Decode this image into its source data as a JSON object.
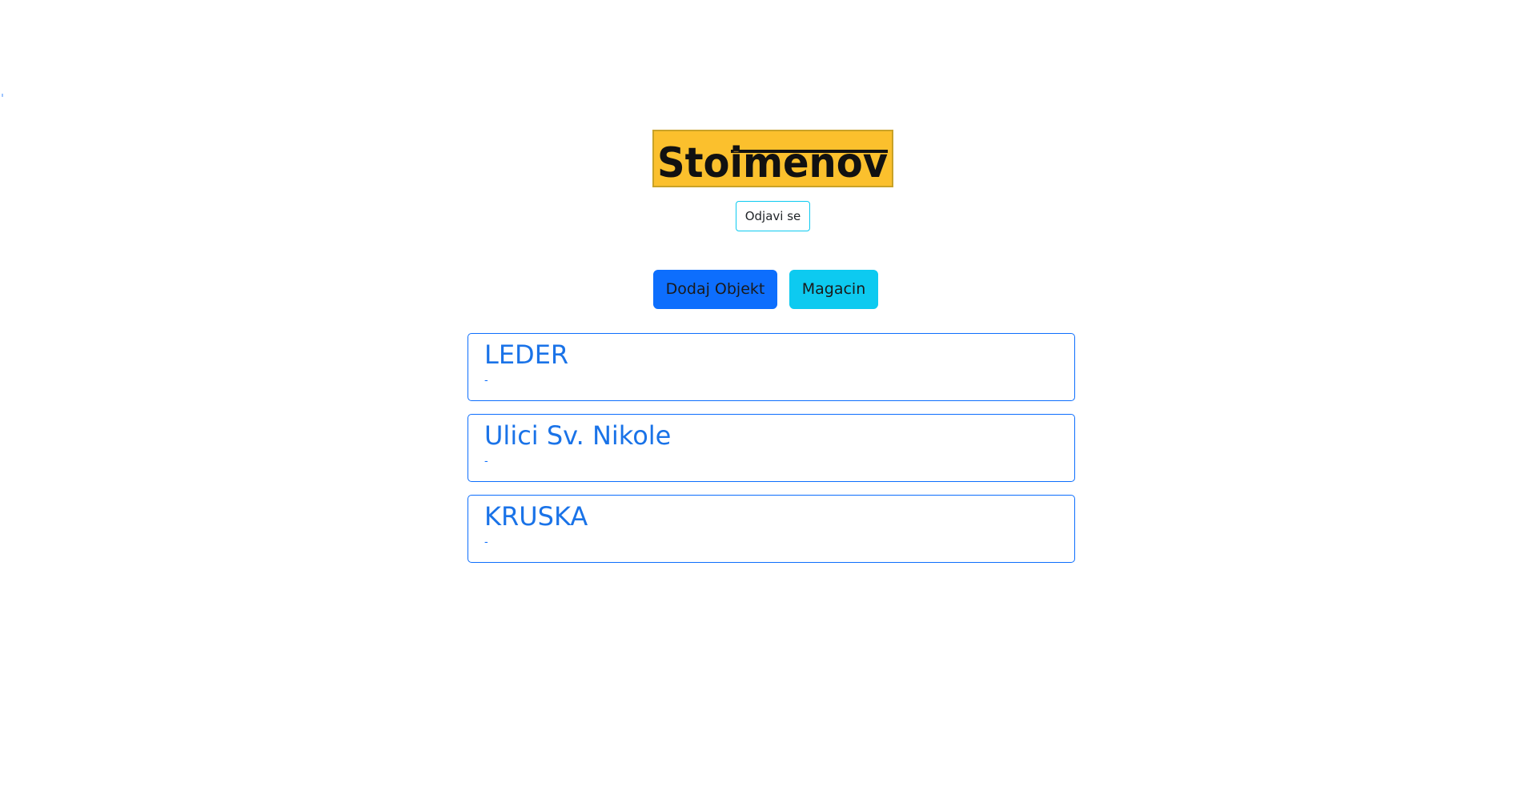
{
  "brand": {
    "logo_text": "Stoimenov",
    "logo_bg": "#fbc02d"
  },
  "header": {
    "logout_label": "Odjavi se"
  },
  "actions": {
    "add_object_label": "Dodaj Objekt",
    "warehouse_label": "Magacin"
  },
  "objects": [
    {
      "title": "LEDER",
      "subtitle": "-"
    },
    {
      "title": "Ulici Sv. Nikole",
      "subtitle": "-"
    },
    {
      "title": "KRUSKA",
      "subtitle": "-"
    }
  ],
  "colors": {
    "primary": "#0d6efd",
    "info": "#0dcaf0",
    "title_blue": "#1a73e8"
  }
}
